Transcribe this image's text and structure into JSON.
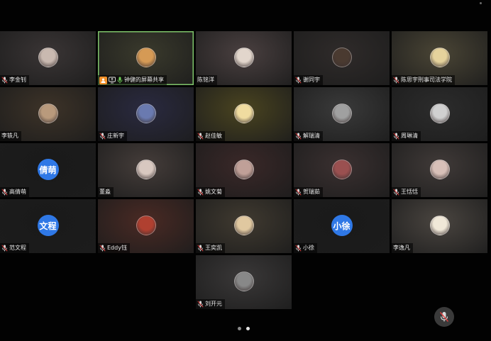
{
  "participants": [
    {
      "name": "李金钊",
      "muted": true,
      "avatar": "photo",
      "bg": "#3a3535",
      "avatar_color": "#c9b9b0"
    },
    {
      "name": "钟健的屏幕共享",
      "muted": false,
      "avatar": "photo",
      "bg": "#3a3a2c",
      "avatar_color": "#d59a55",
      "active": true,
      "host": true,
      "sharing": true,
      "mic_on": true
    },
    {
      "name": "陈铭洋",
      "muted": false,
      "avatar": "photo",
      "bg": "#4a4040",
      "avatar_color": "#e2d6cc"
    },
    {
      "name": "谢同宇",
      "muted": true,
      "avatar": "photo",
      "bg": "#2f2b2a",
      "avatar_color": "#4a3a30"
    },
    {
      "name": "陈思宇刑事司法学院",
      "muted": true,
      "avatar": "photo",
      "bg": "#4a4535",
      "avatar_color": "#e5d29c"
    },
    {
      "name": "李轶凡",
      "muted": false,
      "avatar": "photo",
      "bg": "#3d3328",
      "avatar_color": "#b99a7c"
    },
    {
      "name": "庄新宇",
      "muted": true,
      "avatar": "photo",
      "bg": "#2a2a40",
      "avatar_color": "#6a7ab0"
    },
    {
      "name": "赵佳敏",
      "muted": true,
      "avatar": "photo",
      "bg": "#4a4420",
      "avatar_color": "#f0dca0"
    },
    {
      "name": "解瑞清",
      "muted": true,
      "avatar": "photo",
      "bg": "#3a3a3a",
      "avatar_color": "#a0a0a0"
    },
    {
      "name": "周琳清",
      "muted": true,
      "avatar": "photo",
      "bg": "#2c2c2c",
      "avatar_color": "#d0d0d0"
    },
    {
      "name": "高倩萌",
      "muted": true,
      "avatar": "text",
      "avatar_text": "倩萌",
      "bg": "#1a1a1a"
    },
    {
      "name": "董淼",
      "muted": false,
      "avatar": "photo",
      "bg": "#453d3a",
      "avatar_color": "#d8c8c0"
    },
    {
      "name": "姚文菊",
      "muted": true,
      "avatar": "photo",
      "bg": "#3a2828",
      "avatar_color": "#c0a098"
    },
    {
      "name": "贺瑞茹",
      "muted": true,
      "avatar": "photo",
      "bg": "#3a3030",
      "avatar_color": "#9a5050"
    },
    {
      "name": "王恬恬",
      "muted": true,
      "avatar": "photo",
      "bg": "#403a38",
      "avatar_color": "#d8c0b8"
    },
    {
      "name": "范文程",
      "muted": true,
      "avatar": "text",
      "avatar_text": "文程",
      "bg": "#1a1a1a"
    },
    {
      "name": "Eddy钰",
      "muted": true,
      "avatar": "photo",
      "bg": "#4a2a24",
      "avatar_color": "#b04030"
    },
    {
      "name": "王奕凯",
      "muted": true,
      "avatar": "photo",
      "bg": "#403a30",
      "avatar_color": "#e0c8a0"
    },
    {
      "name": "小徐",
      "muted": true,
      "avatar": "text",
      "avatar_text": "小徐",
      "bg": "#1a1a1a"
    },
    {
      "name": "李逸凡",
      "muted": false,
      "avatar": "photo",
      "bg": "#4a4540",
      "avatar_color": "#f0e8d8"
    },
    {
      "name": "刘开元",
      "muted": true,
      "avatar": "photo",
      "bg": "#3a3838",
      "avatar_color": "#888888"
    }
  ],
  "pagination": {
    "pages": 2,
    "current": 1
  },
  "icons": {
    "muted_mic": "mic-muted-icon",
    "mute_all": "mic-muted-icon"
  }
}
